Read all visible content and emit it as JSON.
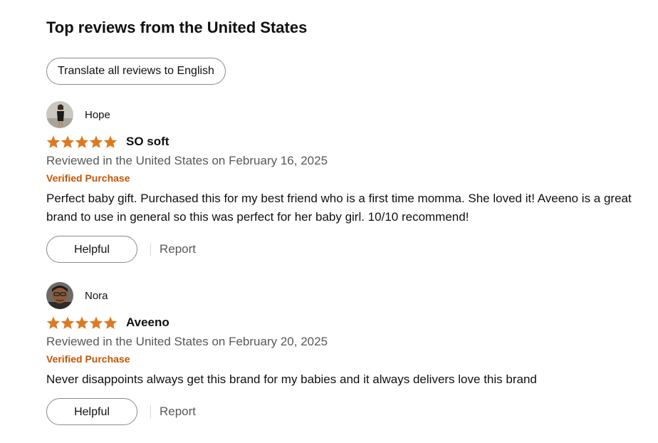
{
  "section": {
    "title": "Top reviews from the United States",
    "translate_label": "Translate all reviews to English"
  },
  "colors": {
    "star": "#de7921",
    "verified": "#c45500",
    "muted_text": "#565959",
    "text": "#0f1111",
    "button_border": "#888c8c"
  },
  "reviews": [
    {
      "author": "Hope",
      "avatar_icon": "user-avatar-photo",
      "rating": 5,
      "max_rating": 5,
      "title": "SO soft",
      "date": "Reviewed in the United States on February 16, 2025",
      "badge": "Verified Purchase",
      "body": "Perfect baby gift. Purchased this for my best friend who is a first time momma. She loved it! Aveeno is a great brand to use in general so this was perfect for her baby girl. 10/10 recommend!",
      "helpful_label": "Helpful",
      "report_label": "Report"
    },
    {
      "author": "Nora",
      "avatar_icon": "user-avatar-photo",
      "rating": 5,
      "max_rating": 5,
      "title": "Aveeno",
      "date": "Reviewed in the United States on February 20, 2025",
      "badge": "Verified Purchase",
      "body": "Never disappoints always get this brand for my babies and it always delivers love this brand",
      "helpful_label": "Helpful",
      "report_label": "Report"
    }
  ]
}
